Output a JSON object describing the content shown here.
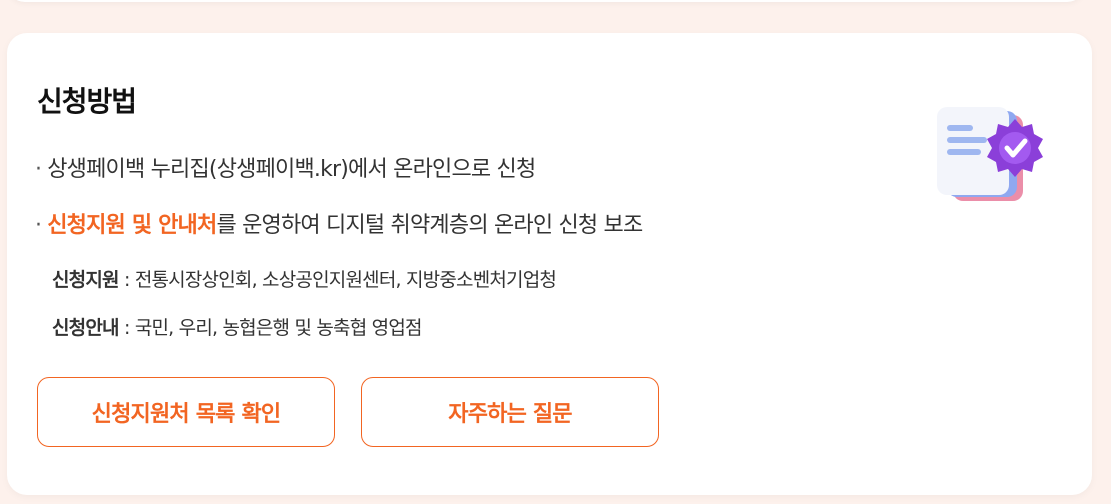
{
  "section": {
    "title": "신청방법",
    "bullet_dot": "·",
    "bullet1": "상생페이백 누리집(상생페이백.kr)에서 온라인으로 신청",
    "bullet2_highlight": "신청지원 및 안내처",
    "bullet2_rest": "를 운영하여 디지털 취약계층의 온라인 신청 보조",
    "support_label": "신청지원",
    "support_text": " : 전통시장상인회, 소상공인지원센터, 지방중소벤처기업청",
    "guide_label": "신청안내",
    "guide_text": " : 국민, 우리, 농협은행 및 농축협 영업점"
  },
  "buttons": {
    "list_label": "신청지원처 목록 확인",
    "faq_label": "자주하는 질문"
  },
  "icons": {
    "document": "document-check-icon"
  },
  "colors": {
    "accent": "#f26522",
    "background": "#fdf1ec",
    "card": "#ffffff"
  }
}
